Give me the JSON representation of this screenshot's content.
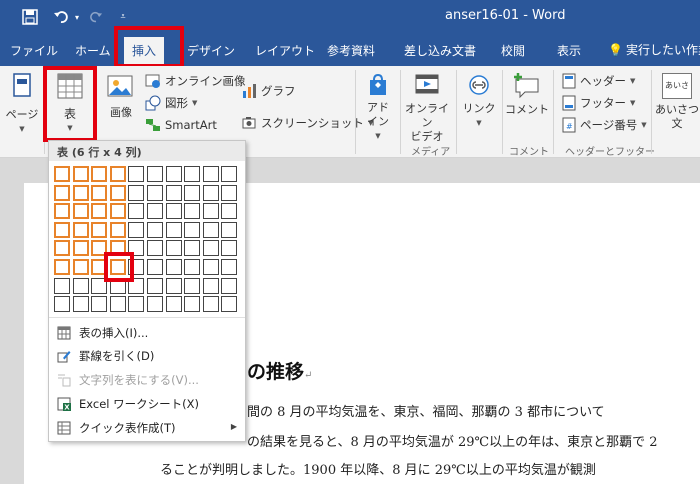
{
  "window": {
    "title": "anser16-01  -  Word"
  },
  "tabs": [
    {
      "label": "ファイル"
    },
    {
      "label": "ホーム"
    },
    {
      "label": "挿入"
    },
    {
      "label": "デザイン"
    },
    {
      "label": "レイアウト"
    },
    {
      "label": "参考資料"
    },
    {
      "label": "差し込み文書"
    },
    {
      "label": "校閲"
    },
    {
      "label": "表示"
    },
    {
      "label": "実行したい作業"
    }
  ],
  "ribbon": {
    "pages_label": "ページ",
    "table_label": "表",
    "picture_label": "画像",
    "online_picture_label": "オンライン画像",
    "shapes_label": "図形",
    "smartart_label": "SmartArt",
    "chart_label": "グラフ",
    "screenshot_label": "スクリーンショット",
    "addins_label": "アドイン",
    "online_video_label_1": "オンライン",
    "online_video_label_2": "ビデオ",
    "link_label": "リンク",
    "comment_label": "コメント",
    "header_label": "ヘッダー",
    "footer_label": "フッター",
    "page_number_label": "ページ番号",
    "greeting_label_1": "あいさつ",
    "greeting_label_2": "文",
    "greeting_icon_text": "あいさつ",
    "groups": {
      "media": "メディア",
      "comments": "コメント",
      "header_footer": "ヘッダーとフッター"
    }
  },
  "table_dropdown": {
    "header": "表 (6 行 x 4 列)",
    "grid": {
      "columns": 10,
      "rows": 8,
      "selected_columns": 4,
      "selected_rows": 6
    },
    "items": [
      {
        "label": "表の挿入(I)...",
        "enabled": true
      },
      {
        "label": "罫線を引く(D)",
        "enabled": true
      },
      {
        "label": "文字列を表にする(V)...",
        "enabled": false
      },
      {
        "label": "Excel ワークシート(X)",
        "enabled": true
      },
      {
        "label": "クイック表作成(T)",
        "enabled": true
      }
    ]
  },
  "document": {
    "heading": "の推移",
    "lines": [
      "間の 8 月の平均気温を、東京、福岡、那覇の 3 都市について",
      "の結果を見ると、8 月の平均気温が 29℃以上の年は、東京と那覇で 2",
      "ることが判明しました。1900 年以降、8 月に 29℃以上の平均気温が観測"
    ]
  }
}
